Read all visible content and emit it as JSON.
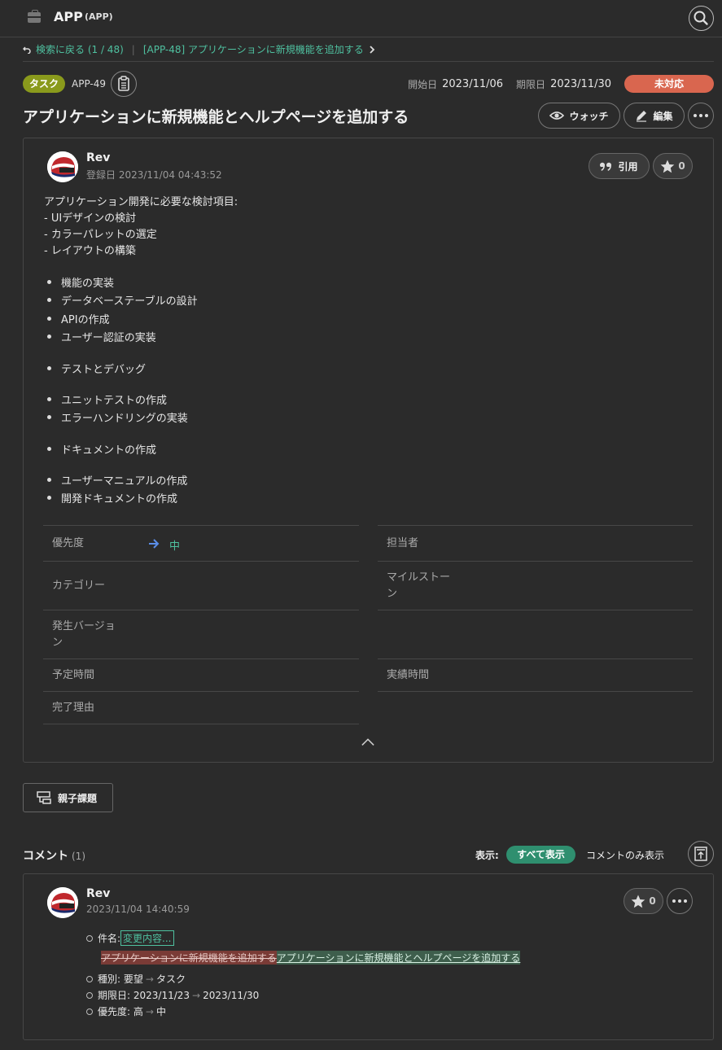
{
  "header": {
    "app_name": "APP",
    "app_key": "(APP)"
  },
  "breadcrumb": {
    "back": "検索に戻る (1 / 48)",
    "parent": "[APP-48] アプリケーションに新規機能を追加する"
  },
  "issue": {
    "type": "タスク",
    "key": "APP-49",
    "start_label": "開始日",
    "start_date": "2023/11/06",
    "due_label": "期限日",
    "due_date": "2023/11/30",
    "status": "未対応",
    "status_color": "#d9664f",
    "title": "アプリケーションに新規機能とヘルプページを追加する",
    "watch_label": "ウォッチ",
    "edit_label": "編集"
  },
  "post": {
    "author": "Rev",
    "created": "登録日  2023/11/04 04:43:52",
    "quote_label": "引用",
    "star_count": "0",
    "description_lines": [
      "アプリケーション開発に必要な検討項目:",
      "- UIデザインの検討",
      "- カラーパレットの選定",
      "- レイアウトの構築"
    ],
    "bullets": [
      "機能の実装",
      "データベーステーブルの設計",
      "APIの作成",
      "ユーザー認証の実装",
      "テストとデバッグ",
      "ユニットテストの作成",
      "エラーハンドリングの実装",
      "ドキュメントの作成",
      "ユーザーマニュアルの作成",
      "開発ドキュメントの作成"
    ]
  },
  "properties": {
    "priority_label": "優先度",
    "priority_value": "中",
    "assignee_label": "担当者",
    "category_label": "カテゴリー",
    "milestone_label": "マイルストーン",
    "version_label": "発生バージョン",
    "estimated_label": "予定時間",
    "actual_label": "実績時間",
    "resolution_label": "完了理由"
  },
  "parent_button": "親子課題",
  "comments": {
    "title": "コメント",
    "count": "(1)",
    "show_label": "表示:",
    "show_all": "すべて表示",
    "show_comments_only": "コメントのみ表示",
    "item": {
      "author": "Rev",
      "timestamp": "2023/11/04 14:40:59",
      "star_count": "0",
      "subject_label": "件名:",
      "subject_link": "変更内容...",
      "old_subject": "アプリケーションに新規機能を追加する",
      "new_subject": "アプリケーションに新規機能とヘルプページを追加する",
      "type_change": {
        "label": "種別:",
        "from": "要望",
        "to": "タスク"
      },
      "due_change": {
        "label": "期限日:",
        "from": "2023/11/23",
        "to": "2023/11/30"
      },
      "priority_change": {
        "label": "優先度:",
        "from": "高",
        "to": "中"
      }
    }
  },
  "icons": [
    "briefcase-icon",
    "search-icon",
    "back-arrow-icon",
    "chevron-right-icon",
    "clipboard-icon",
    "eye-icon",
    "pencil-icon",
    "more-icon",
    "quote-icon",
    "star-icon",
    "arrow-right-icon",
    "chevron-up-icon",
    "hierarchy-icon",
    "jump-to-top-icon"
  ]
}
